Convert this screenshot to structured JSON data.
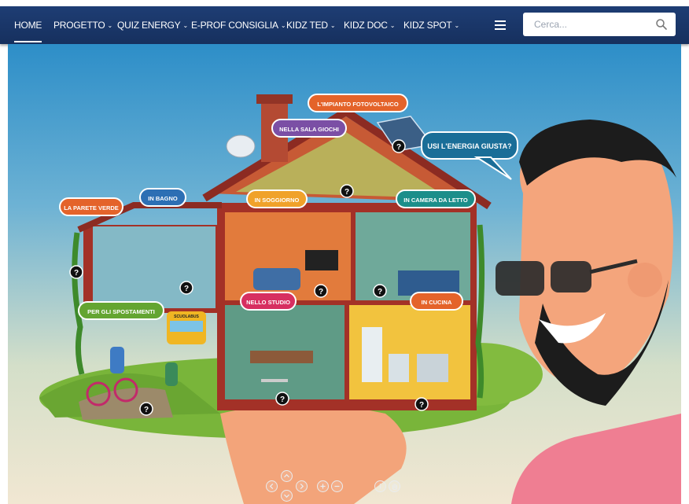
{
  "page": {
    "top_fragment": ""
  },
  "nav": {
    "items": [
      {
        "label": "HOME",
        "dropdown": false,
        "active": true
      },
      {
        "label": "PROGETTO",
        "dropdown": true
      },
      {
        "label": "QUIZ ENERGY",
        "dropdown": true
      },
      {
        "label": "E-PROF CONSIGLIA",
        "dropdown": true
      },
      {
        "label": "KIDZ TED",
        "dropdown": true
      },
      {
        "label": "KIDZ DOC",
        "dropdown": true
      },
      {
        "label": "KIDZ SPOT",
        "dropdown": true
      }
    ],
    "menu_icon": "hamburger-icon",
    "search_placeholder": "Cerca...",
    "search_icon": "search-icon"
  },
  "scene": {
    "speech_bubble": "USI L'ENERGIA GIUSTA?",
    "labels": {
      "fotovoltaico": "L'IMPIANTO FOTOVOLTAICO",
      "sala_giochi": "NELLA SALA GIOCHI",
      "parete_verde": "LA PARETE VERDE",
      "bagno": "IN BAGNO",
      "soggiorno": "IN SOGGIORNO",
      "camera": "IN CAMERA DA LETTO",
      "spostamenti": "PER GLI SPOSTAMENTI",
      "studio": "NELLO STUDIO",
      "cucina": "IN CUCINA"
    },
    "bus_sign": "SCUOLABUS",
    "hotspot_symbol": "?"
  },
  "controls": {
    "pan": [
      "pan-up-icon",
      "pan-left-icon",
      "pan-right-icon",
      "pan-down-icon"
    ],
    "zoom": [
      "zoom-in-icon",
      "zoom-out-icon"
    ],
    "other": [
      "info-icon",
      "hand-icon"
    ]
  },
  "colors": {
    "navbar": "#1e3d74",
    "sky_top": "#2d8ec8",
    "sky_bottom": "#f1e7d2",
    "roof": "#b8392c",
    "label_orange": "#e4632a",
    "label_blue": "#2d6fb4",
    "label_purple": "#7b4fa5",
    "label_green": "#64a531",
    "label_teal": "#1b8e8a"
  }
}
